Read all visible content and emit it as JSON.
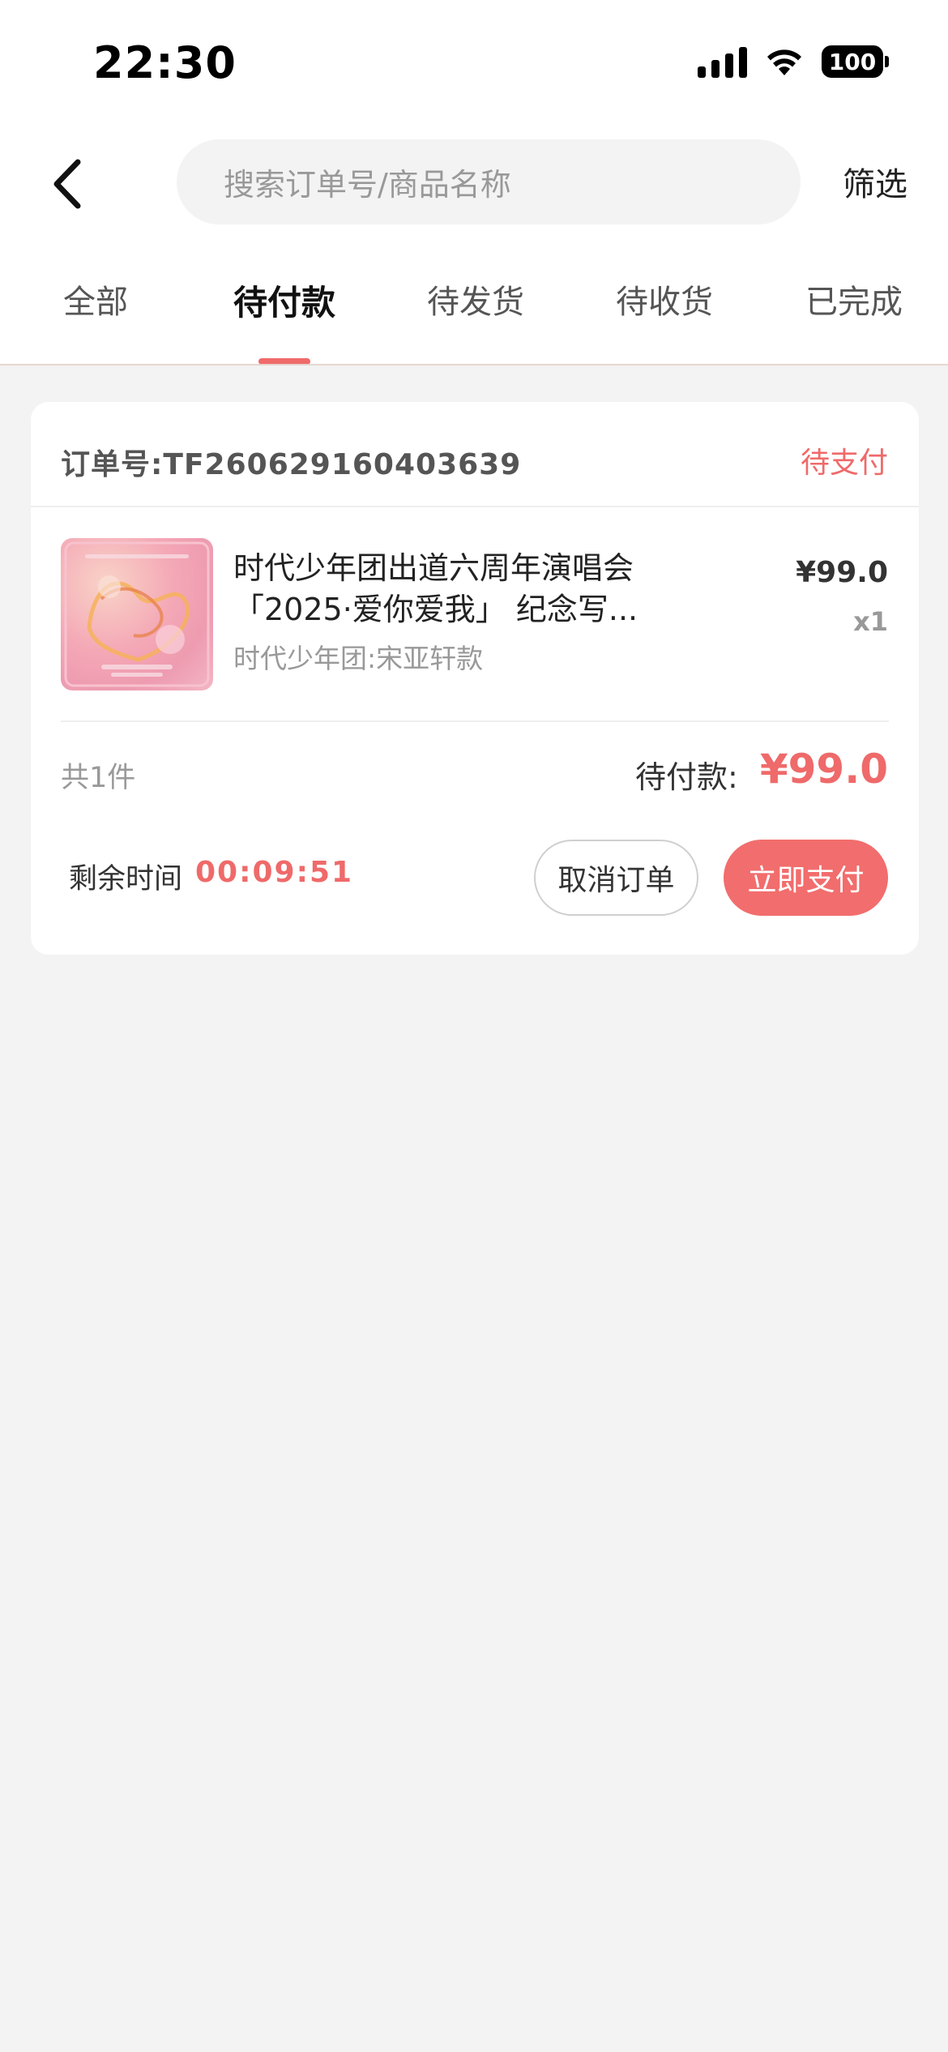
{
  "status_bar": {
    "time": "22:30",
    "battery": "100"
  },
  "header": {
    "search_placeholder": "搜索订单号/商品名称",
    "filter_label": "筛选"
  },
  "tabs": [
    {
      "label": "全部",
      "active": false
    },
    {
      "label": "待付款",
      "active": true
    },
    {
      "label": "待发货",
      "active": false
    },
    {
      "label": "待收货",
      "active": false
    },
    {
      "label": "已完成",
      "active": false
    }
  ],
  "order": {
    "order_number": "订单号:TF260629160403639",
    "status": "待支付",
    "product_name": "时代少年团出道六周年演唱会「2025·爱你爱我」 纪念写...",
    "product_variant": "时代少年团:宋亚轩款",
    "price": "¥99.0",
    "quantity": "x1",
    "total_count": "共1件",
    "total_label": "待付款:",
    "total_amount": "¥99.0",
    "remaining_label": "剩余时间",
    "remaining_time": "00:09:51",
    "cancel_label": "取消订单",
    "pay_label": "立即支付"
  },
  "colors": {
    "accent": "#ef6a6a",
    "pay_button": "#f26d6d",
    "background": "#f3f3f3"
  },
  "icons": {
    "back": "chevron-left-icon",
    "signal": "cellular-signal-icon",
    "wifi": "wifi-icon",
    "battery": "battery-icon"
  }
}
